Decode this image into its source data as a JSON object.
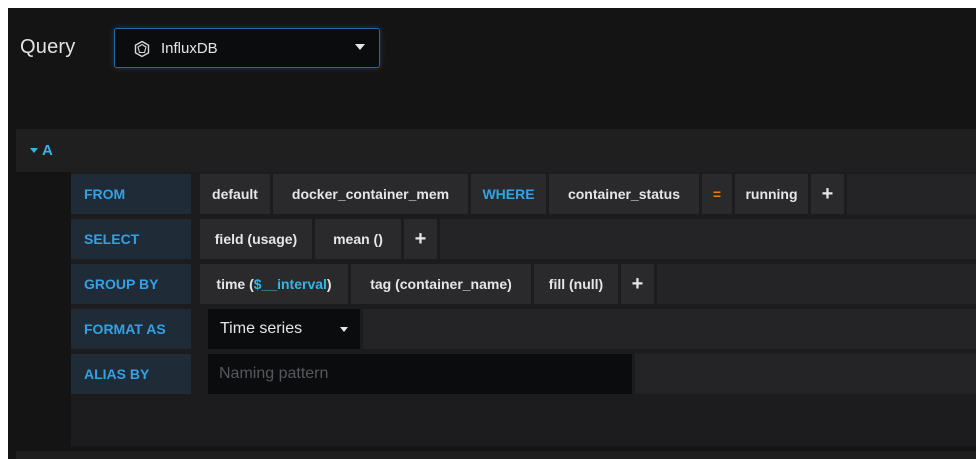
{
  "query": {
    "title": "Query",
    "datasource": "InfluxDB"
  },
  "query_row": {
    "ref": "A"
  },
  "from": {
    "keyword": "FROM",
    "policy": "default",
    "measurement": "docker_container_mem",
    "where_keyword": "WHERE",
    "tag_key": "container_status",
    "operator": "=",
    "tag_value": "running",
    "add": "+"
  },
  "select": {
    "keyword": "SELECT",
    "field": "field (usage)",
    "aggregate": "mean ()",
    "add": "+"
  },
  "group_by": {
    "keyword": "GROUP BY",
    "time_prefix": "time (",
    "time_var": "$__interval",
    "time_suffix": ")",
    "tag": "tag (container_name)",
    "fill": "fill (null)",
    "add": "+"
  },
  "format_as": {
    "keyword": "FORMAT AS",
    "value": "Time series"
  },
  "alias_by": {
    "keyword": "ALIAS BY",
    "placeholder": "Naming pattern",
    "value": ""
  },
  "colors": {
    "accent": "#33b5e5",
    "keyword": "#33a2e5",
    "operator": "#eb7b18"
  }
}
